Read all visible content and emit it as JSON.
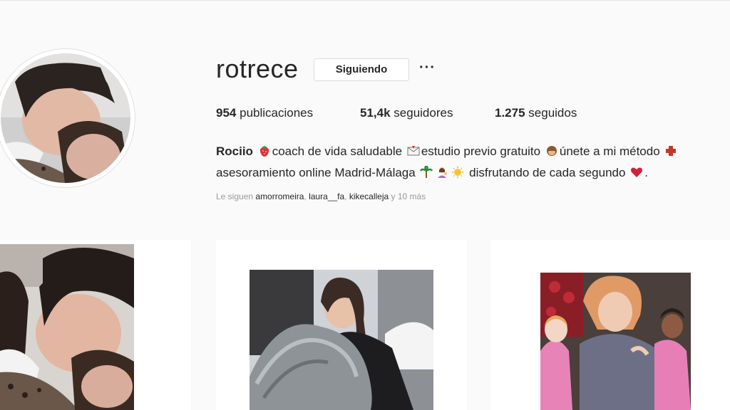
{
  "profile": {
    "username": "rotrece",
    "follow_button": "Siguiendo",
    "more_button": "···"
  },
  "stats": {
    "posts_count": "954",
    "posts_label": "publicaciones",
    "followers_count": "51,4k",
    "followers_label": "seguidores",
    "following_count": "1.275",
    "following_label": "seguidos"
  },
  "bio": {
    "name": "Rociio",
    "line1_a": "coach de vida saludable",
    "line1_b": "estudio previo gratuito",
    "line1_c": "únete a mi método",
    "line2_a": "asesoramiento online Madrid-Málaga",
    "line2_b": "disfrutando de cada segundo",
    "line2_end": "."
  },
  "followed_by": {
    "prefix": "Le siguen",
    "user1": "amorromeira",
    "sep1": ",",
    "user2": "laura__fa",
    "sep2": ",",
    "user3": "kikecalleja",
    "suffix": "y 10 más"
  },
  "icons": [
    "strawberry-icon",
    "envelope-icon",
    "monkey-icon",
    "palm-tree-icon",
    "woman-tipping-hand-icon",
    "sun-icon",
    "heart-icon",
    "more-dots-icon"
  ],
  "colors": {
    "background": "#fafafa",
    "text": "#262626",
    "muted": "#999999",
    "border": "#dbdbdb"
  }
}
